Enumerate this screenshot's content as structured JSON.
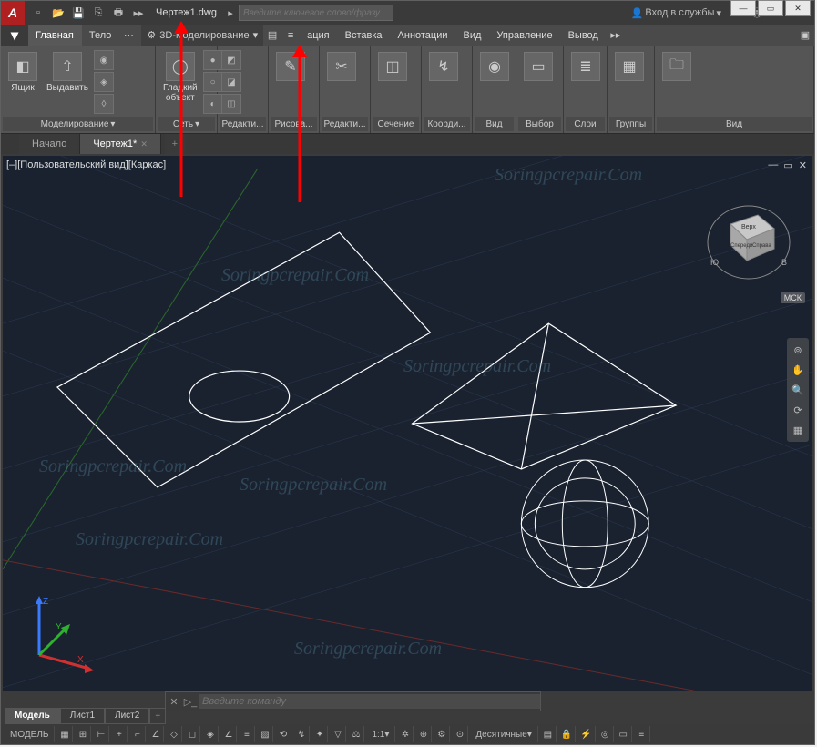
{
  "title": "Чертеж1.dwg",
  "search_placeholder": "Введите ключевое слово/фразу",
  "signin": "Вход в службы",
  "qat_icons": [
    "new-icon",
    "open-icon",
    "save-icon",
    "saveas-icon",
    "print-icon",
    "more-icon"
  ],
  "tabs": [
    "Главная",
    "Тело",
    "",
    "",
    "",
    "ация",
    "Вставка",
    "Аннотации",
    "Вид",
    "Управление",
    "Вывод"
  ],
  "workspace": "3D-моделирование",
  "ribbon": {
    "panels": [
      {
        "title": "Моделирование",
        "buttons": [
          {
            "label": "Ящик",
            "icon": "box-icon"
          },
          {
            "label": "Выдавить",
            "icon": "extrude-icon"
          },
          {
            "label": "Гладкий объект",
            "icon": "smooth-icon"
          }
        ]
      },
      {
        "title": "Сеть",
        "buttons": []
      },
      {
        "title": "Редакти...",
        "buttons": [
          {
            "label": "",
            "icon": ""
          }
        ]
      },
      {
        "title": "Рисова...",
        "buttons": [
          {
            "label": "",
            "icon": "draw-icon"
          }
        ]
      },
      {
        "title": "Редакти...",
        "buttons": [
          {
            "label": "",
            "icon": "edit-icon"
          }
        ]
      },
      {
        "title": "Сечение",
        "buttons": [
          {
            "label": "",
            "icon": "section-icon"
          }
        ]
      },
      {
        "title": "Коорди...",
        "buttons": [
          {
            "label": "",
            "icon": "ucs-icon"
          }
        ]
      },
      {
        "title": "Вид",
        "buttons": [
          {
            "label": "",
            "icon": "view-icon"
          }
        ]
      },
      {
        "title": "Выбор",
        "buttons": [
          {
            "label": "",
            "icon": "select-icon"
          }
        ]
      },
      {
        "title": "Слои",
        "buttons": [
          {
            "label": "",
            "icon": "layers-icon"
          }
        ]
      },
      {
        "title": "Группы",
        "buttons": [
          {
            "label": "",
            "icon": "groups-icon"
          }
        ]
      },
      {
        "title": "Вид",
        "buttons": [
          {
            "label": "",
            "icon": "view2-icon"
          }
        ]
      }
    ]
  },
  "filetabs": {
    "start": "Начало",
    "active": "Чертеж1*"
  },
  "view_label": "[–][Пользовательский вид][Каркас]",
  "view_ctrl": {
    "min": "—",
    "max": "▭",
    "close": "✕"
  },
  "wcs": "МСК",
  "viewcube": {
    "top": "Верх",
    "front": "Спереди",
    "right": "Справа",
    "s": "Ю",
    "e": "В"
  },
  "cmd_placeholder": "Введите команду",
  "layouts": [
    "Модель",
    "Лист1",
    "Лист2"
  ],
  "status": {
    "model": "МОДЕЛЬ",
    "scale": "1:1",
    "units": "Десятичные"
  },
  "watermark": "Soringpcrepair.Com"
}
